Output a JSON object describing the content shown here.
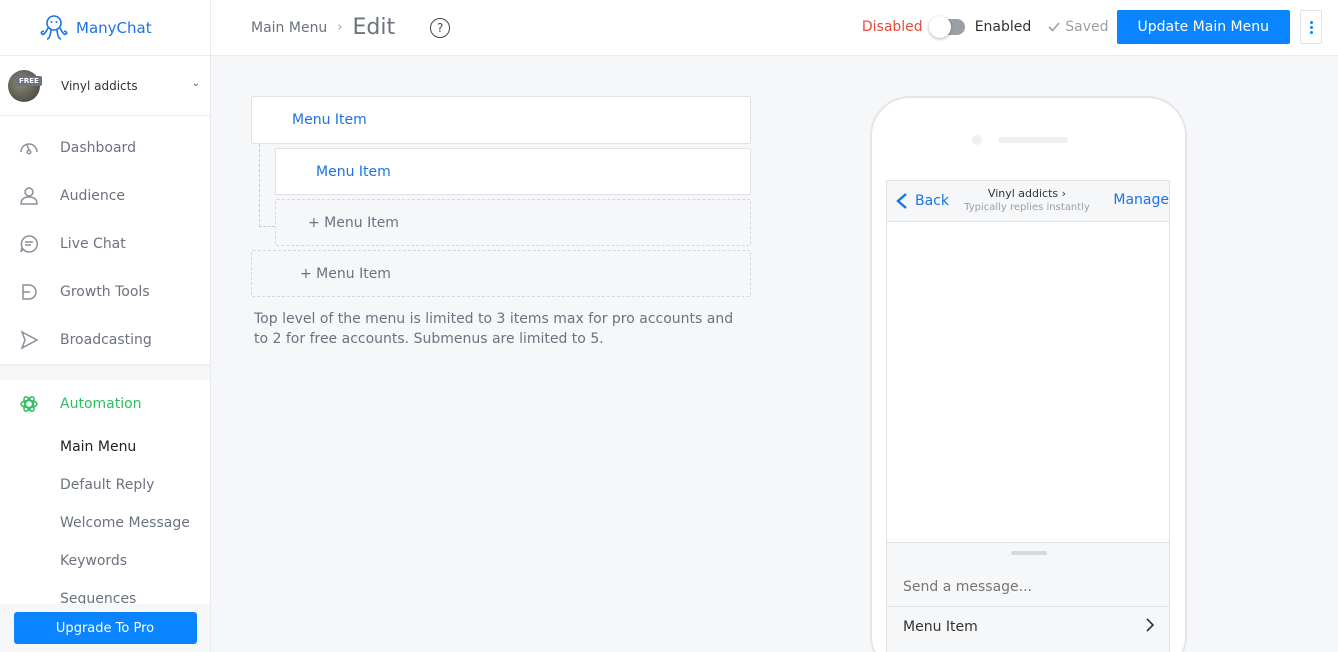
{
  "app": {
    "brand": "ManyChat"
  },
  "account": {
    "name": "Vinyl addicts",
    "badge": "FREE"
  },
  "nav": {
    "items": [
      {
        "label": "Dashboard",
        "icon": "dashboard-icon"
      },
      {
        "label": "Audience",
        "icon": "user-icon"
      },
      {
        "label": "Live Chat",
        "icon": "chat-icon"
      },
      {
        "label": "Growth Tools",
        "icon": "growth-icon"
      },
      {
        "label": "Broadcasting",
        "icon": "send-icon"
      }
    ],
    "automation": {
      "label": "Automation",
      "sub_items": [
        "Main Menu",
        "Default Reply",
        "Welcome Message",
        "Keywords",
        "Sequences"
      ]
    },
    "upgrade_label": "Upgrade To Pro"
  },
  "header": {
    "breadcrumb": "Main Menu",
    "title": "Edit",
    "help": "?",
    "disabled_label": "Disabled",
    "enabled_label": "Enabled",
    "saved_label": "Saved",
    "update_label": "Update Main Menu"
  },
  "editor": {
    "top_item": "Menu Item",
    "sub_item": "Menu Item",
    "add_sub": "+ Menu Item",
    "add_top": "+ Menu Item",
    "note": "Top level of the menu is limited to 3 items max for pro accounts and to 2 for free accounts. Submenus are limited to 5."
  },
  "preview": {
    "back": "Back",
    "page_name": "Vinyl addicts",
    "page_sub": "Typically replies instantly",
    "manage": "Manage",
    "placeholder": "Send a message...",
    "menu_item": "Menu Item"
  },
  "colors": {
    "accent": "#0a84ff",
    "automation": "#2cbf5f",
    "disabled": "#e74c3c"
  }
}
